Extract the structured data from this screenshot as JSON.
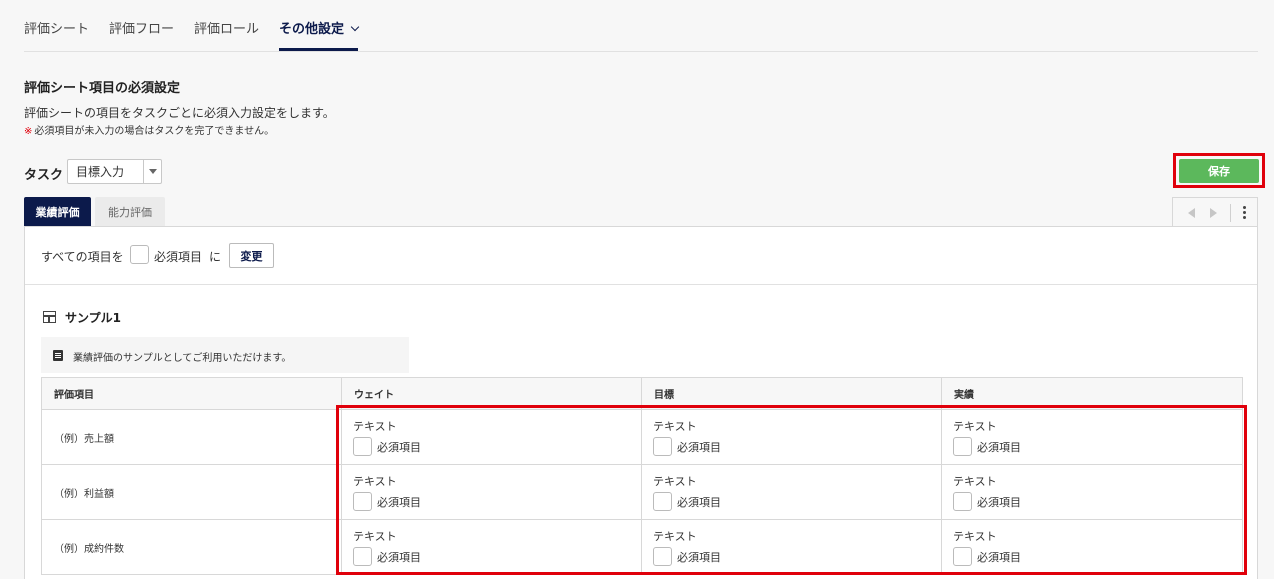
{
  "top_tabs": [
    {
      "label": "評価シート"
    },
    {
      "label": "評価フロー"
    },
    {
      "label": "評価ロール"
    },
    {
      "label": "その他設定"
    }
  ],
  "section": {
    "title": "評価シート項目の必須設定",
    "description": "評価シートの項目をタスクごとに必須入力設定をします。",
    "note_mark": "※",
    "note": "必須項目が未入力の場合はタスクを完了できません。"
  },
  "task": {
    "label": "タスク",
    "selected": "目標入力"
  },
  "save_label": "保存",
  "sub_tabs": [
    {
      "label": "業績評価"
    },
    {
      "label": "能力評価"
    }
  ],
  "bulk": {
    "prefix": "すべての項目を",
    "checkbox_label": "必須項目",
    "suffix": "に",
    "change_label": "変更"
  },
  "sample": {
    "title": "サンプル1",
    "memo": "業績評価のサンプルとしてご利用いただけます。"
  },
  "table": {
    "headers": [
      "評価項目",
      "ウェイト",
      "目標",
      "実績"
    ],
    "rows": [
      {
        "item": "（例）売上額",
        "cells": [
          {
            "type": "テキスト",
            "req": "必須項目"
          },
          {
            "type": "テキスト",
            "req": "必須項目"
          },
          {
            "type": "テキスト",
            "req": "必須項目"
          }
        ]
      },
      {
        "item": "（例）利益額",
        "cells": [
          {
            "type": "テキスト",
            "req": "必須項目"
          },
          {
            "type": "テキスト",
            "req": "必須項目"
          },
          {
            "type": "テキスト",
            "req": "必須項目"
          }
        ]
      },
      {
        "item": "（例）成約件数",
        "cells": [
          {
            "type": "テキスト",
            "req": "必須項目"
          },
          {
            "type": "テキスト",
            "req": "必須項目"
          },
          {
            "type": "テキスト",
            "req": "必須項目"
          }
        ]
      }
    ]
  },
  "colors": {
    "primary": "#0c1a4b",
    "save_green": "#5cb85c",
    "highlight_red": "#e0000b"
  }
}
